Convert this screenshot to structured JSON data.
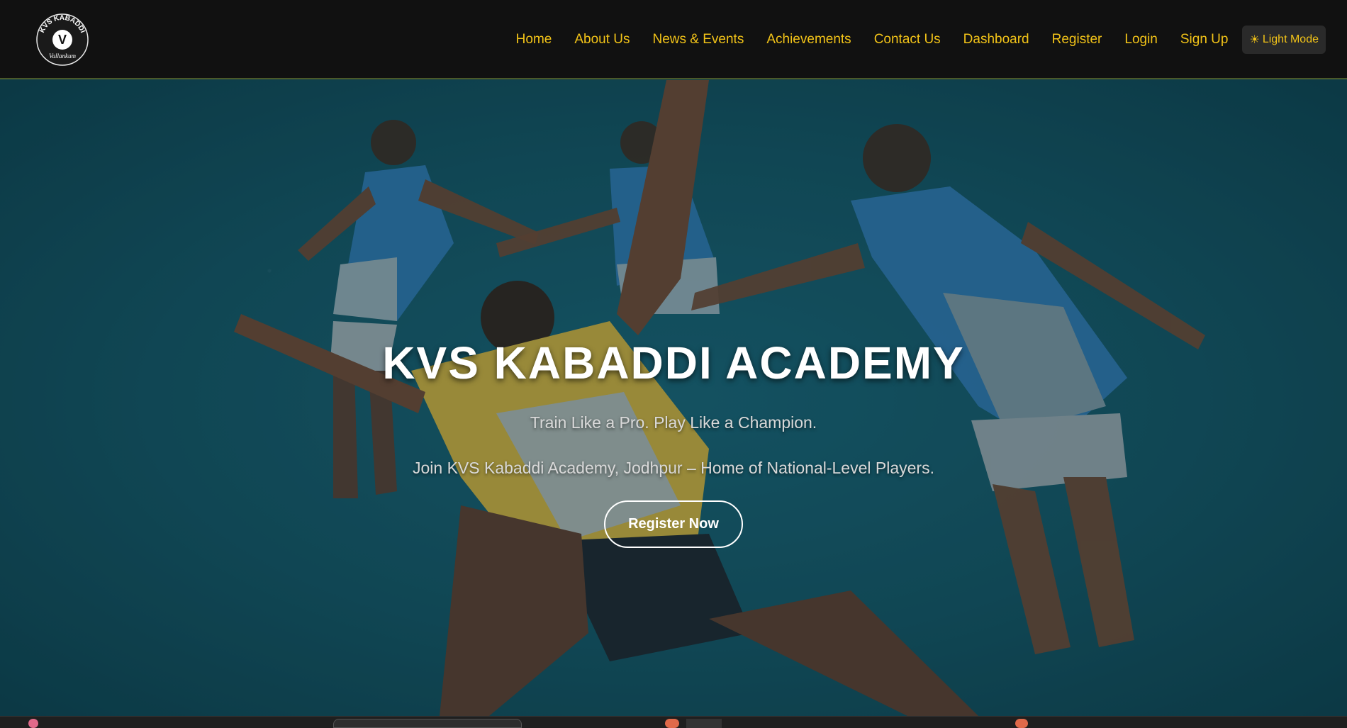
{
  "brand": {
    "logo_top_text": "KVS KABADDI",
    "logo_bottom_text": "Vallankum",
    "logo_letter": "V"
  },
  "nav": {
    "items": [
      {
        "label": "Home",
        "name": "nav-home"
      },
      {
        "label": "About Us",
        "name": "nav-about-us"
      },
      {
        "label": "News & Events",
        "name": "nav-news-events"
      },
      {
        "label": "Achievements",
        "name": "nav-achievements"
      },
      {
        "label": "Contact Us",
        "name": "nav-contact-us"
      },
      {
        "label": "Dashboard",
        "name": "nav-dashboard"
      },
      {
        "label": "Register",
        "name": "nav-register"
      },
      {
        "label": "Login",
        "name": "nav-login"
      },
      {
        "label": "Sign Up",
        "name": "nav-sign-up"
      }
    ],
    "mode_toggle": {
      "icon": "sun-icon",
      "label": "Light Mode"
    }
  },
  "hero": {
    "title": "KVS KABADDI ACADEMY",
    "tagline": "Train Like a Pro. Play Like a Champion.",
    "subtitle": "Join KVS Kabaddi Academy, Jodhpur – Home of National-Level Players.",
    "cta_label": "Register Now"
  },
  "colors": {
    "nav_bg": "#111111",
    "nav_link": "#f2c318",
    "hero_bg": "#124a58",
    "cta_border": "#ffffff"
  }
}
